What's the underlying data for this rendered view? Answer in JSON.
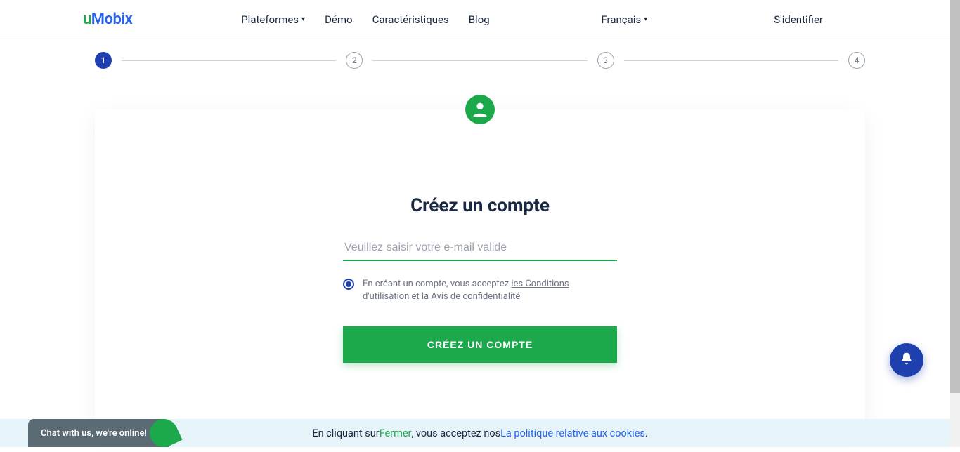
{
  "logo": {
    "part1": "u",
    "part2": "Mobix"
  },
  "nav": {
    "platforms": "Plateformes",
    "demo": "Démo",
    "features": "Caractéristiques",
    "blog": "Blog"
  },
  "language": "Français",
  "signin": "S'identifier",
  "stepper": {
    "s1": "1",
    "s2": "2",
    "s3": "3",
    "s4": "4"
  },
  "form": {
    "title": "Créez un compte",
    "email_placeholder": "Veuillez saisir votre e-mail valide",
    "consent_prefix": "En créant un compte, vous acceptez ",
    "terms_link": "les Conditions d'utilisation",
    "consent_middle": " et la ",
    "privacy_link": "Avis de confidentialité",
    "submit": "CRÉEZ UN COMPTE"
  },
  "cookie": {
    "prefix": "En cliquant sur ",
    "close": "Fermer",
    "mid": " , vous acceptez nos ",
    "policy": "La politique relative aux cookies",
    "suffix": " ."
  },
  "chat": {
    "text": "Chat with us, we're online!"
  }
}
